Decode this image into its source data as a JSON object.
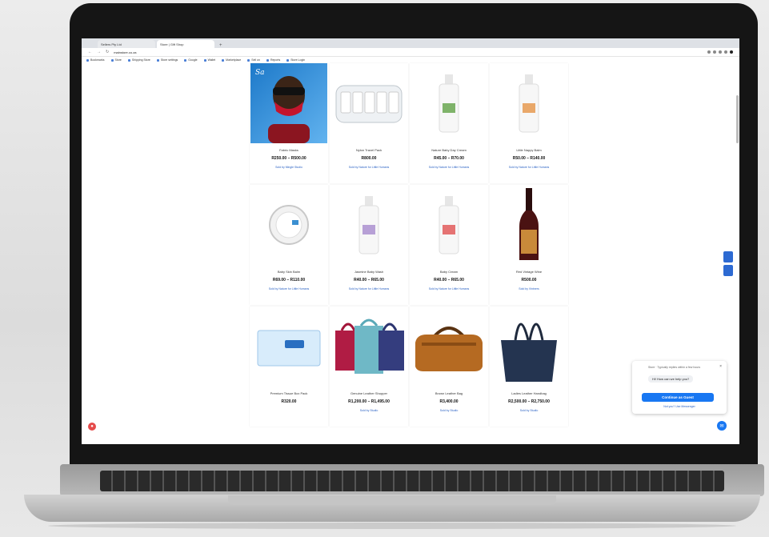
{
  "browser": {
    "tabs": [
      {
        "label": "Sellers Pty Ltd"
      },
      {
        "label": "Store | Gift Shop"
      }
    ],
    "url": "mainstore.co.za",
    "bookmarks": [
      "Bookmarks",
      "Store",
      "Shipping Store",
      "Store settings",
      "Google",
      "Wallet",
      "Marketplace",
      "Sell on",
      "Reports",
      "Store Login"
    ]
  },
  "products": [
    {
      "name": "Fabric Masks",
      "price": "R250.00 – R500.00",
      "vendor": "Sold by Mingle Studio"
    },
    {
      "name": "Nylon Travel Pack",
      "price": "R800.00",
      "vendor": "Sold by Nature for Little Humans"
    },
    {
      "name": "Nature Baby Day Cream",
      "price": "R45.00 – R70.00",
      "vendor": "Sold by Nature for Little Humans"
    },
    {
      "name": "Little Nappy Balm",
      "price": "R50.00 – R140.00",
      "vendor": "Sold by Nature for Little Humans"
    },
    {
      "name": "Baby Skin Balm",
      "price": "R69.00 – R110.00",
      "vendor": "Sold by Nature for Little Humans"
    },
    {
      "name": "Jasmine Baby Wash",
      "price": "R40.00 – R65.00",
      "vendor": "Sold by Nature for Little Humans"
    },
    {
      "name": "Baby Cream",
      "price": "R40.00 – R65.00",
      "vendor": "Sold by Nature for Little Humans"
    },
    {
      "name": "Red Vintage Wine",
      "price": "R500.00",
      "vendor": "Sold by Vintners"
    },
    {
      "name": "Premium Tissue Box Pack",
      "price": "R320.00",
      "vendor": ""
    },
    {
      "name": "Genuine Leather Shopper",
      "price": "R1,200.00 – R1,495.00",
      "vendor": "Sold by Studio"
    },
    {
      "name": "Brown Leather Bag",
      "price": "R3,400.00",
      "vendor": "Sold by Studio"
    },
    {
      "name": "Ladies Leather Handbag",
      "price": "R2,500.00 – R2,750.00",
      "vendor": "Sold by Studio"
    }
  ],
  "chat": {
    "header": "Store · Typically replies within a few hours",
    "message": "Hi! How can we help you?",
    "button": "Continue as Guest",
    "link": "Not you? Use Messenger"
  },
  "colors": {
    "accent": "#1877f2",
    "link": "#2b62c4",
    "lid": "#151515"
  }
}
